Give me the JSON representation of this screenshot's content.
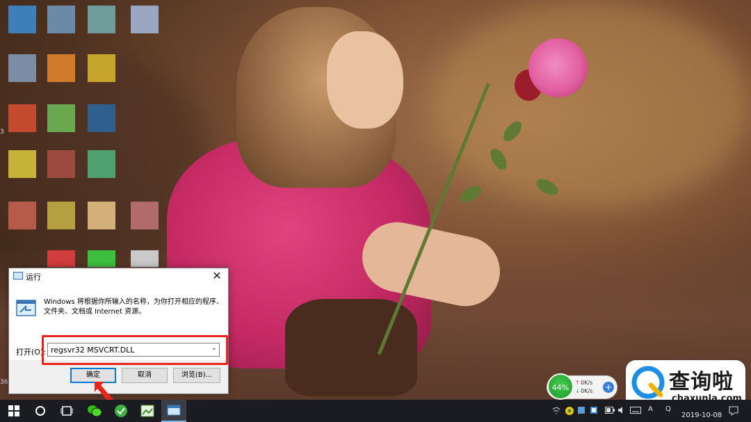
{
  "dialog": {
    "title": "运行",
    "description": "Windows 将根据你所输入的名称，为你打开相应的程序、文件夹、文档或 Internet 资源。",
    "open_label": "打开(O):",
    "input_value": "regsvr32 MSVCRT.DLL",
    "ok_label": "确定",
    "cancel_label": "取消",
    "browse_label": "浏览(B)...",
    "close_glyph": "✕"
  },
  "speed_widget": {
    "percent": "44%",
    "upload": "0K/s",
    "download": "0K/s",
    "plus": "+"
  },
  "watermark": {
    "chinese": "查询啦",
    "domain": "chaxunla.com"
  },
  "taskbar": {
    "date": "2019-10-08",
    "lang": "A",
    "ime": "Q"
  },
  "edge_marks": {
    "mark_3": "3",
    "mark_36": "36"
  },
  "colors": {
    "highlight": "#e8251c",
    "ok_border": "#0078d7",
    "taskbar": "#1a1c22"
  }
}
